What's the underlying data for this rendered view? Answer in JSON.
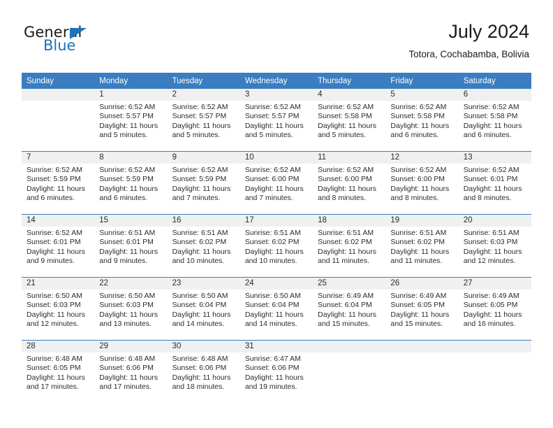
{
  "brand": {
    "name_part1": "General",
    "name_part2": "Blue",
    "logo_icon": "triangle-logo-icon"
  },
  "header": {
    "title": "July 2024",
    "subtitle": "Totora, Cochabamba, Bolivia"
  },
  "colors": {
    "header_blue": "#3a7dc0",
    "brand_blue": "#1f72bd",
    "daynum_band": "#f0f0f0",
    "text": "#2b2b2b"
  },
  "weekdays": [
    "Sunday",
    "Monday",
    "Tuesday",
    "Wednesday",
    "Thursday",
    "Friday",
    "Saturday"
  ],
  "labels": {
    "sunrise_prefix": "Sunrise:",
    "sunset_prefix": "Sunset:",
    "daylight_prefix": "Daylight:"
  },
  "weeks": [
    [
      {
        "day": "",
        "sunrise": "",
        "sunset": "",
        "daylight_line1": "",
        "daylight_line2": ""
      },
      {
        "day": "1",
        "sunrise": "Sunrise: 6:52 AM",
        "sunset": "Sunset: 5:57 PM",
        "daylight_line1": "Daylight: 11 hours",
        "daylight_line2": "and 5 minutes."
      },
      {
        "day": "2",
        "sunrise": "Sunrise: 6:52 AM",
        "sunset": "Sunset: 5:57 PM",
        "daylight_line1": "Daylight: 11 hours",
        "daylight_line2": "and 5 minutes."
      },
      {
        "day": "3",
        "sunrise": "Sunrise: 6:52 AM",
        "sunset": "Sunset: 5:57 PM",
        "daylight_line1": "Daylight: 11 hours",
        "daylight_line2": "and 5 minutes."
      },
      {
        "day": "4",
        "sunrise": "Sunrise: 6:52 AM",
        "sunset": "Sunset: 5:58 PM",
        "daylight_line1": "Daylight: 11 hours",
        "daylight_line2": "and 5 minutes."
      },
      {
        "day": "5",
        "sunrise": "Sunrise: 6:52 AM",
        "sunset": "Sunset: 5:58 PM",
        "daylight_line1": "Daylight: 11 hours",
        "daylight_line2": "and 6 minutes."
      },
      {
        "day": "6",
        "sunrise": "Sunrise: 6:52 AM",
        "sunset": "Sunset: 5:58 PM",
        "daylight_line1": "Daylight: 11 hours",
        "daylight_line2": "and 6 minutes."
      }
    ],
    [
      {
        "day": "7",
        "sunrise": "Sunrise: 6:52 AM",
        "sunset": "Sunset: 5:59 PM",
        "daylight_line1": "Daylight: 11 hours",
        "daylight_line2": "and 6 minutes."
      },
      {
        "day": "8",
        "sunrise": "Sunrise: 6:52 AM",
        "sunset": "Sunset: 5:59 PM",
        "daylight_line1": "Daylight: 11 hours",
        "daylight_line2": "and 6 minutes."
      },
      {
        "day": "9",
        "sunrise": "Sunrise: 6:52 AM",
        "sunset": "Sunset: 5:59 PM",
        "daylight_line1": "Daylight: 11 hours",
        "daylight_line2": "and 7 minutes."
      },
      {
        "day": "10",
        "sunrise": "Sunrise: 6:52 AM",
        "sunset": "Sunset: 6:00 PM",
        "daylight_line1": "Daylight: 11 hours",
        "daylight_line2": "and 7 minutes."
      },
      {
        "day": "11",
        "sunrise": "Sunrise: 6:52 AM",
        "sunset": "Sunset: 6:00 PM",
        "daylight_line1": "Daylight: 11 hours",
        "daylight_line2": "and 8 minutes."
      },
      {
        "day": "12",
        "sunrise": "Sunrise: 6:52 AM",
        "sunset": "Sunset: 6:00 PM",
        "daylight_line1": "Daylight: 11 hours",
        "daylight_line2": "and 8 minutes."
      },
      {
        "day": "13",
        "sunrise": "Sunrise: 6:52 AM",
        "sunset": "Sunset: 6:01 PM",
        "daylight_line1": "Daylight: 11 hours",
        "daylight_line2": "and 8 minutes."
      }
    ],
    [
      {
        "day": "14",
        "sunrise": "Sunrise: 6:52 AM",
        "sunset": "Sunset: 6:01 PM",
        "daylight_line1": "Daylight: 11 hours",
        "daylight_line2": "and 9 minutes."
      },
      {
        "day": "15",
        "sunrise": "Sunrise: 6:51 AM",
        "sunset": "Sunset: 6:01 PM",
        "daylight_line1": "Daylight: 11 hours",
        "daylight_line2": "and 9 minutes."
      },
      {
        "day": "16",
        "sunrise": "Sunrise: 6:51 AM",
        "sunset": "Sunset: 6:02 PM",
        "daylight_line1": "Daylight: 11 hours",
        "daylight_line2": "and 10 minutes."
      },
      {
        "day": "17",
        "sunrise": "Sunrise: 6:51 AM",
        "sunset": "Sunset: 6:02 PM",
        "daylight_line1": "Daylight: 11 hours",
        "daylight_line2": "and 10 minutes."
      },
      {
        "day": "18",
        "sunrise": "Sunrise: 6:51 AM",
        "sunset": "Sunset: 6:02 PM",
        "daylight_line1": "Daylight: 11 hours",
        "daylight_line2": "and 11 minutes."
      },
      {
        "day": "19",
        "sunrise": "Sunrise: 6:51 AM",
        "sunset": "Sunset: 6:02 PM",
        "daylight_line1": "Daylight: 11 hours",
        "daylight_line2": "and 11 minutes."
      },
      {
        "day": "20",
        "sunrise": "Sunrise: 6:51 AM",
        "sunset": "Sunset: 6:03 PM",
        "daylight_line1": "Daylight: 11 hours",
        "daylight_line2": "and 12 minutes."
      }
    ],
    [
      {
        "day": "21",
        "sunrise": "Sunrise: 6:50 AM",
        "sunset": "Sunset: 6:03 PM",
        "daylight_line1": "Daylight: 11 hours",
        "daylight_line2": "and 12 minutes."
      },
      {
        "day": "22",
        "sunrise": "Sunrise: 6:50 AM",
        "sunset": "Sunset: 6:03 PM",
        "daylight_line1": "Daylight: 11 hours",
        "daylight_line2": "and 13 minutes."
      },
      {
        "day": "23",
        "sunrise": "Sunrise: 6:50 AM",
        "sunset": "Sunset: 6:04 PM",
        "daylight_line1": "Daylight: 11 hours",
        "daylight_line2": "and 14 minutes."
      },
      {
        "day": "24",
        "sunrise": "Sunrise: 6:50 AM",
        "sunset": "Sunset: 6:04 PM",
        "daylight_line1": "Daylight: 11 hours",
        "daylight_line2": "and 14 minutes."
      },
      {
        "day": "25",
        "sunrise": "Sunrise: 6:49 AM",
        "sunset": "Sunset: 6:04 PM",
        "daylight_line1": "Daylight: 11 hours",
        "daylight_line2": "and 15 minutes."
      },
      {
        "day": "26",
        "sunrise": "Sunrise: 6:49 AM",
        "sunset": "Sunset: 6:05 PM",
        "daylight_line1": "Daylight: 11 hours",
        "daylight_line2": "and 15 minutes."
      },
      {
        "day": "27",
        "sunrise": "Sunrise: 6:49 AM",
        "sunset": "Sunset: 6:05 PM",
        "daylight_line1": "Daylight: 11 hours",
        "daylight_line2": "and 16 minutes."
      }
    ],
    [
      {
        "day": "28",
        "sunrise": "Sunrise: 6:48 AM",
        "sunset": "Sunset: 6:05 PM",
        "daylight_line1": "Daylight: 11 hours",
        "daylight_line2": "and 17 minutes."
      },
      {
        "day": "29",
        "sunrise": "Sunrise: 6:48 AM",
        "sunset": "Sunset: 6:06 PM",
        "daylight_line1": "Daylight: 11 hours",
        "daylight_line2": "and 17 minutes."
      },
      {
        "day": "30",
        "sunrise": "Sunrise: 6:48 AM",
        "sunset": "Sunset: 6:06 PM",
        "daylight_line1": "Daylight: 11 hours",
        "daylight_line2": "and 18 minutes."
      },
      {
        "day": "31",
        "sunrise": "Sunrise: 6:47 AM",
        "sunset": "Sunset: 6:06 PM",
        "daylight_line1": "Daylight: 11 hours",
        "daylight_line2": "and 19 minutes."
      },
      {
        "day": "",
        "sunrise": "",
        "sunset": "",
        "daylight_line1": "",
        "daylight_line2": ""
      },
      {
        "day": "",
        "sunrise": "",
        "sunset": "",
        "daylight_line1": "",
        "daylight_line2": ""
      },
      {
        "day": "",
        "sunrise": "",
        "sunset": "",
        "daylight_line1": "",
        "daylight_line2": ""
      }
    ]
  ]
}
